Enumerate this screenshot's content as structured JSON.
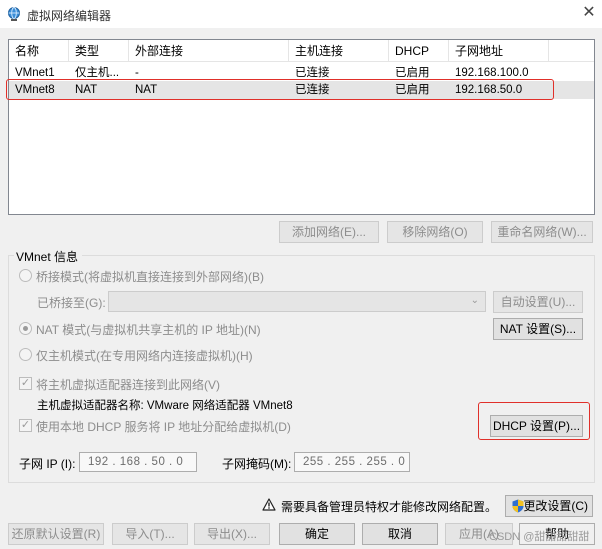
{
  "window": {
    "title": "虚拟网络编辑器",
    "close": "✕"
  },
  "table": {
    "headers": [
      "名称",
      "类型",
      "外部连接",
      "主机连接",
      "DHCP",
      "子网地址"
    ],
    "rows": [
      [
        "VMnet1",
        "仅主机...",
        "-",
        "已连接",
        "已启用",
        "192.168.100.0"
      ],
      [
        "VMnet8",
        "NAT",
        "NAT",
        "已连接",
        "已启用",
        "192.168.50.0"
      ]
    ],
    "selected_row": 1
  },
  "list_buttons": {
    "add": "添加网络(E)...",
    "remove": "移除网络(O)",
    "rename": "重命名网络(W)..."
  },
  "vmnet_info": {
    "legend": "VMnet 信息",
    "bridge_mode": "桥接模式(将虚拟机直接连接到外部网络)(B)",
    "bridged_to_label": "已桥接至(G):",
    "bridged_to_value": "",
    "auto_settings": "自动设置(U)...",
    "nat_mode": "NAT 模式(与虚拟机共享主机的 IP 地址)(N)",
    "nat_settings": "NAT 设置(S)...",
    "host_only_mode": "仅主机模式(在专用网络内连接虚拟机)(H)",
    "connect_host_adapter": "将主机虚拟适配器连接到此网络(V)",
    "host_adapter_name": "主机虚拟适配器名称: VMware 网络适配器 VMnet8",
    "use_dhcp": "使用本地 DHCP 服务将 IP 地址分配给虚拟机(D)",
    "dhcp_settings": "DHCP 设置(P)...",
    "subnet_ip_label": "子网 IP (I):",
    "subnet_ip": "192 . 168 . 50 . 0",
    "subnet_mask_label": "子网掩码(M):",
    "subnet_mask": "255 . 255 . 255 . 0"
  },
  "admin_notice": "需要具备管理员特权才能修改网络配置。",
  "change_settings": "更改设置(C)",
  "footer": {
    "restore": "还原默认设置(R)",
    "import": "导入(T)...",
    "export": "导出(X)...",
    "ok": "确定",
    "cancel": "取消",
    "apply": "应用(A)",
    "help": "帮助"
  },
  "watermark": "CSDN @甜甜甜甜甜",
  "colors": {
    "highlight": "#e0302a",
    "selection": "#e5e5e5",
    "accent": "#0078d7"
  },
  "icons": {
    "app": "network-globe-icon",
    "warning": "warning-icon",
    "uac": "uac-shield-icon"
  }
}
